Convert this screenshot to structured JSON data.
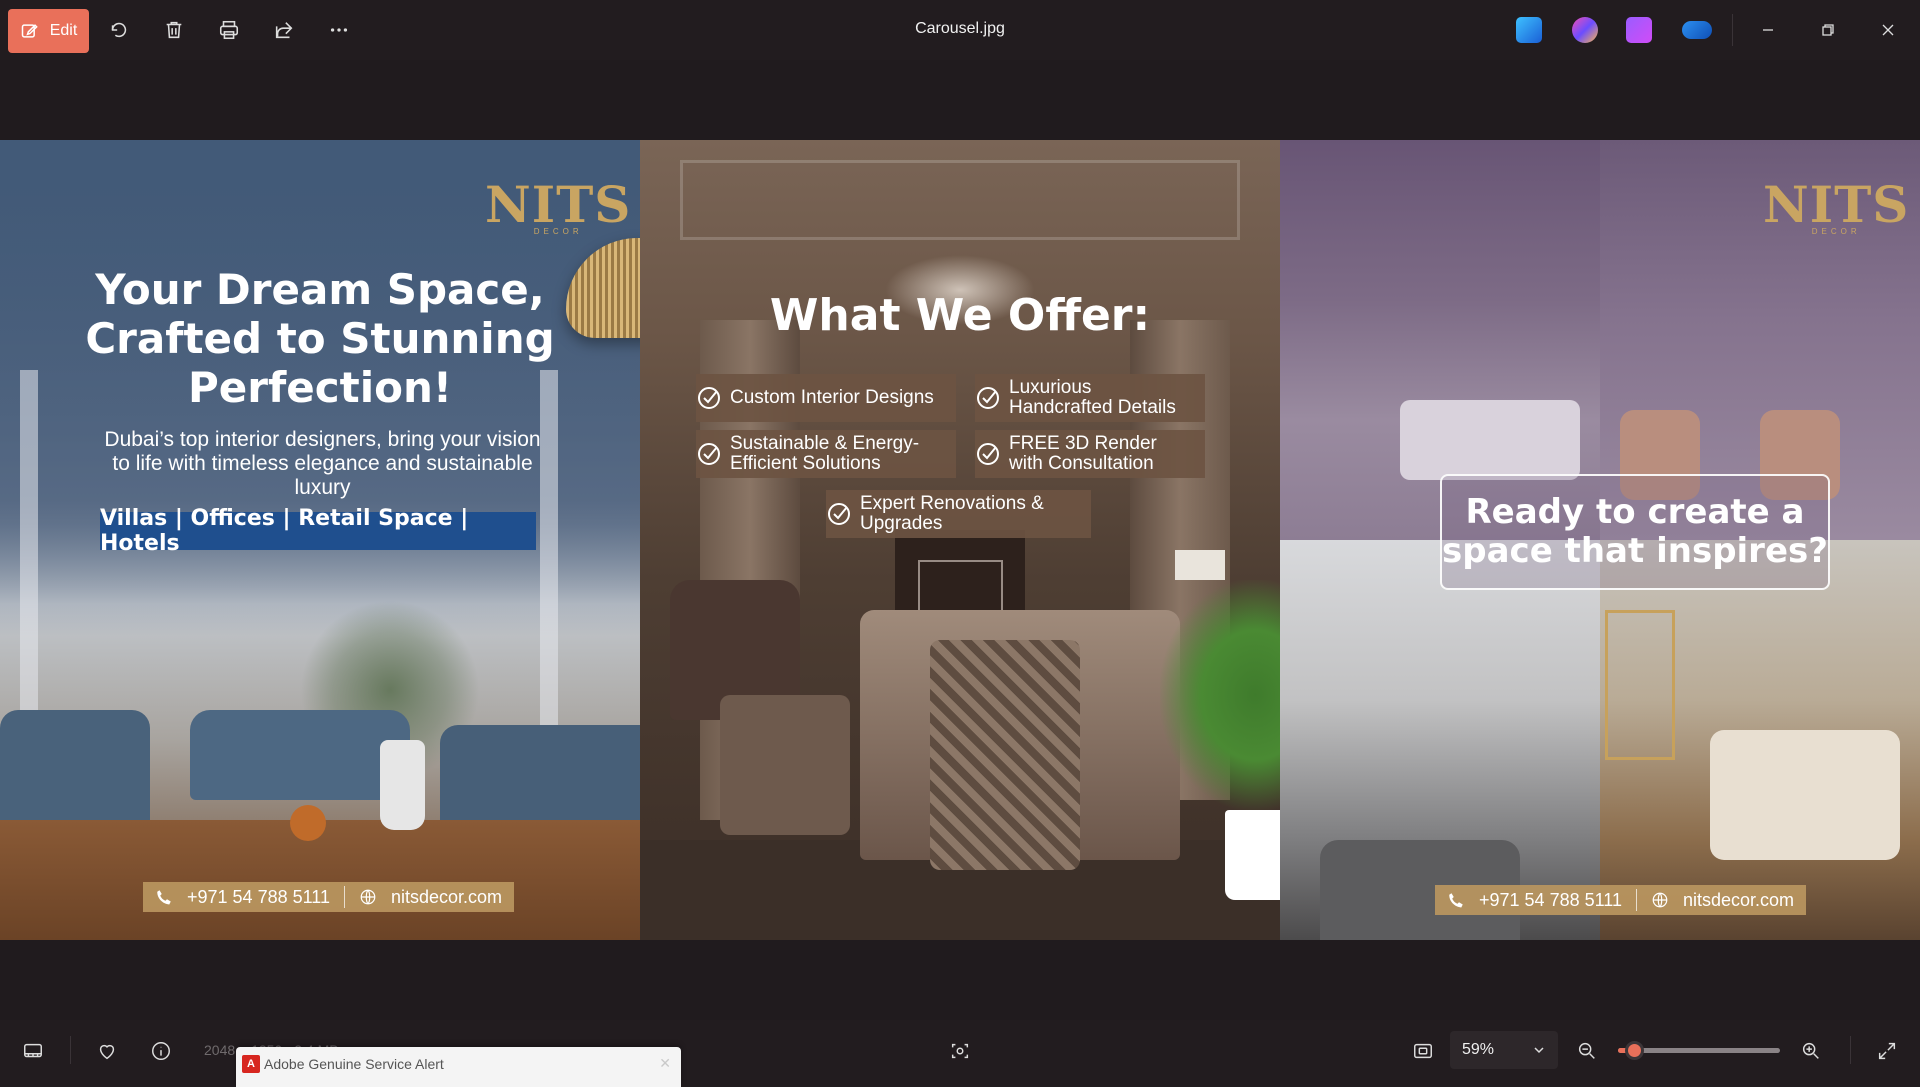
{
  "titlebar": {
    "edit_label": "Edit",
    "title": "Carousel.jpg",
    "icons": [
      "rotate-icon",
      "delete-icon",
      "print-icon",
      "share-icon",
      "more-icon"
    ],
    "app_icons": [
      "photo-editor-icon",
      "copilot-icon",
      "clipchamp-icon",
      "onedrive-icon"
    ],
    "accent": "#e9705a"
  },
  "image": {
    "panel1": {
      "logo": "NITS",
      "logo_sub": "DECOR",
      "headline": "Your Dream Space, Crafted to Stunning Perfection!",
      "subline": "Dubai’s top interior designers, bring your vision to life with timeless elegance and sustainable luxury",
      "sectors": "Villas | Offices | Retail Space | Hotels",
      "phone": "+971 54 788 5111",
      "website": "nitsdecor.com"
    },
    "panel2": {
      "headline": "What We Offer:",
      "offers": [
        "Custom Interior Designs",
        "Luxurious Handcrafted Details",
        "Sustainable & Energy-Efficient Solutions",
        "FREE 3D Render with Consultation",
        "Expert Renovations & Upgrades"
      ]
    },
    "panel3": {
      "logo": "NITS",
      "logo_sub": "DECOR",
      "cta": "Ready to create a space that inspires?",
      "phone": "+971 54 788 5111",
      "website": "nitsdecor.com"
    },
    "colors": {
      "gold": "#c9a562",
      "sector_blue": "#1f4f8e"
    }
  },
  "bottombar": {
    "faded_dimensions": "2048 × 1350",
    "faded_size": "2.4 MB",
    "zoom": "59%",
    "zoom_level_percent": 59,
    "slider_fraction": 0.1
  },
  "notification": {
    "text": "Adobe Genuine Service Alert"
  }
}
